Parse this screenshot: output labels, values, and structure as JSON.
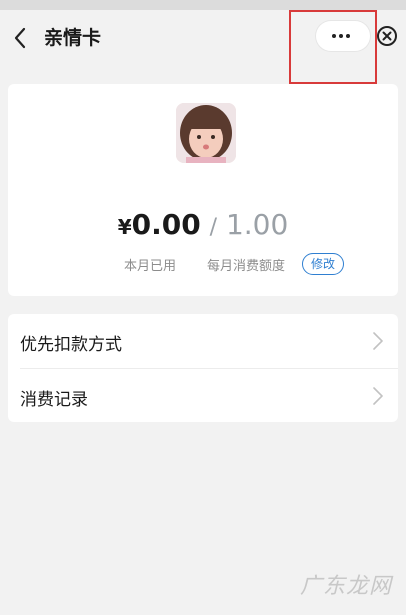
{
  "header": {
    "title": "亲情卡",
    "back_icon": "chevron-left-icon",
    "more_icon": "more-dots-icon",
    "close_icon": "close-circle-icon"
  },
  "card": {
    "currency": "¥",
    "spent": "0.00",
    "separator": "/",
    "limit": "1.00",
    "spent_label": "本月已用",
    "limit_label": "每月消费额度",
    "modify_button": "修改"
  },
  "menu": {
    "items": [
      {
        "label": "优先扣款方式",
        "icon": "chevron-right-icon"
      },
      {
        "label": "消费记录",
        "icon": "chevron-right-icon"
      }
    ]
  },
  "watermark": {
    "text": "广东龙网"
  },
  "colors": {
    "accent": "#2f7fd1",
    "highlight_box": "#d83a3a",
    "background": "#f2f2f2"
  }
}
